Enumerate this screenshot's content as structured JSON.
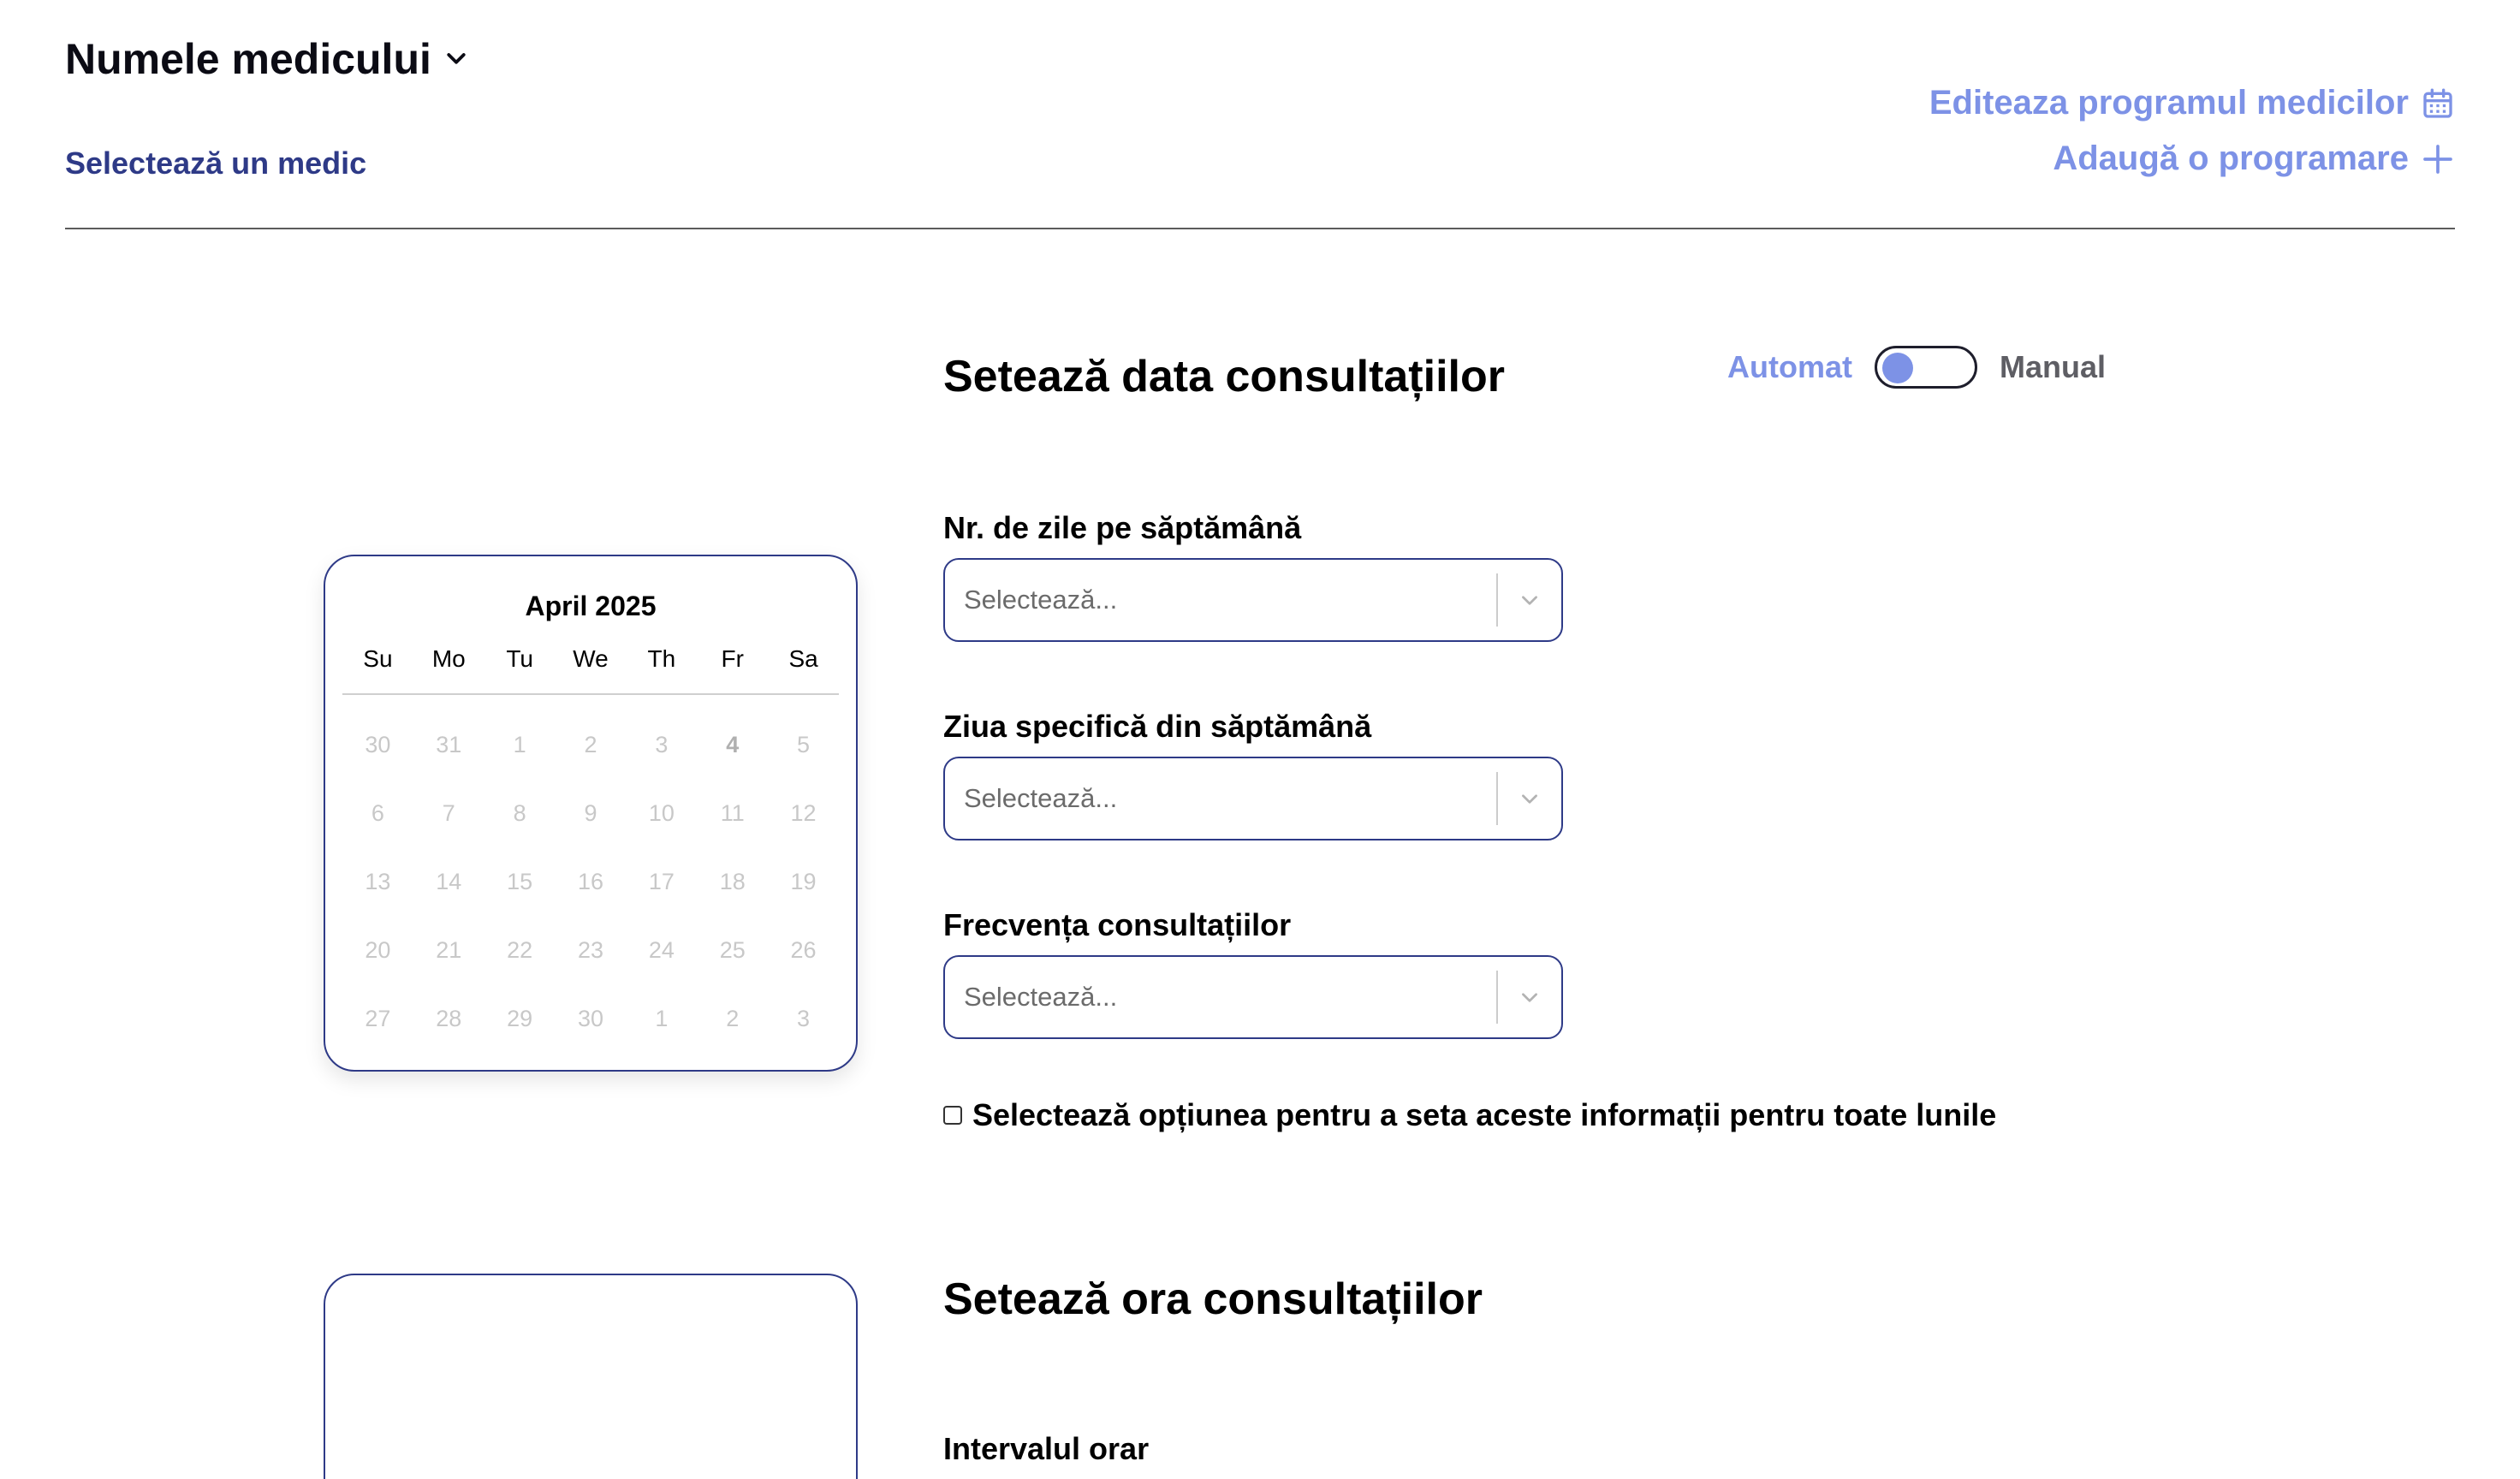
{
  "header": {
    "doctor_name_label": "Numele medicului",
    "select_medic": "Selectează un medic",
    "edit_schedule": "Editeaza programul medicilor",
    "add_appointment": "Adaugă o programare"
  },
  "calendar": {
    "month_label": "April 2025",
    "weekdays": [
      "Su",
      "Mo",
      "Tu",
      "We",
      "Th",
      "Fr",
      "Sa"
    ],
    "weeks": [
      [
        "30",
        "31",
        "1",
        "2",
        "3",
        "4",
        "5"
      ],
      [
        "6",
        "7",
        "8",
        "9",
        "10",
        "11",
        "12"
      ],
      [
        "13",
        "14",
        "15",
        "16",
        "17",
        "18",
        "19"
      ],
      [
        "20",
        "21",
        "22",
        "23",
        "24",
        "25",
        "26"
      ],
      [
        "27",
        "28",
        "29",
        "30",
        "1",
        "2",
        "3"
      ]
    ]
  },
  "date_section": {
    "title": "Setează data consultațiilor",
    "toggle_auto": "Automat",
    "toggle_manual": "Manual",
    "fields": [
      {
        "label": "Nr. de zile pe săptămână",
        "placeholder": "Selectează..."
      },
      {
        "label": "Ziua specifică din săptămână",
        "placeholder": "Selectează..."
      },
      {
        "label": "Frecvența consultațiilor",
        "placeholder": "Selectează..."
      }
    ],
    "all_months_checkbox": "Selectează opțiunea pentru a seta aceste informații pentru toate lunile"
  },
  "time_section": {
    "title": "Setează ora consultațiilor",
    "interval_label": "Intervalul orar"
  },
  "colors": {
    "accent": "#7d92e6",
    "navy": "#2e3a87"
  },
  "icons": {
    "calendar": "calendar-icon",
    "plus": "plus-icon",
    "chevron": "chevron-down-icon"
  }
}
